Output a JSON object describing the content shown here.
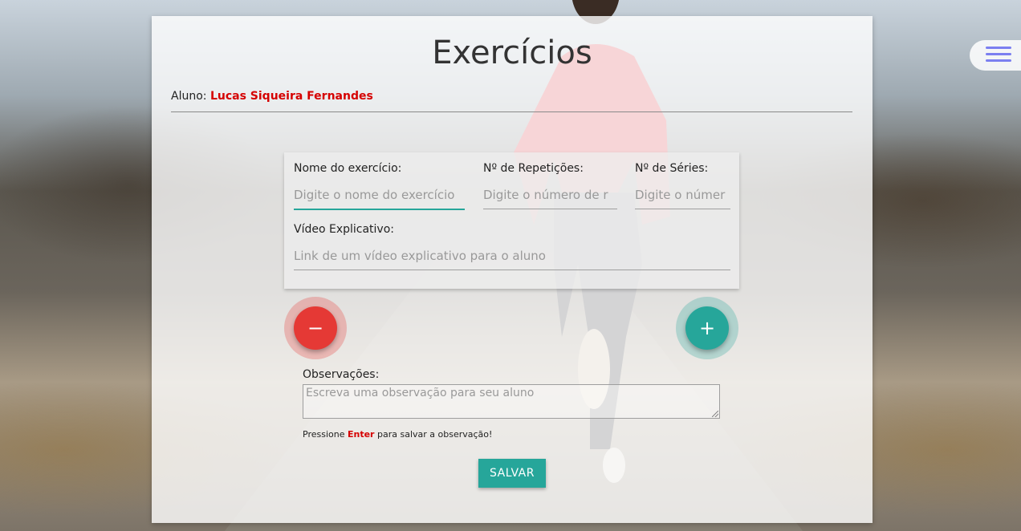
{
  "page": {
    "title": "Exercícios"
  },
  "student": {
    "label": "Aluno:",
    "name": "Lucas Siqueira Fernandes"
  },
  "exercise_form": {
    "name_label": "Nome do exercício:",
    "name_placeholder": "Digite o nome do exercício",
    "reps_label": "Nº de Repetições:",
    "reps_placeholder": "Digite o número de r",
    "sets_label": "Nº de Séries:",
    "sets_placeholder": "Digite o númer",
    "video_label": "Vídeo Explicativo:",
    "video_placeholder": "Link de um vídeo explicativo para o aluno"
  },
  "actions": {
    "remove_icon": "−",
    "add_icon": "+"
  },
  "observations": {
    "label": "Observações:",
    "placeholder": "Escreva uma observação para seu aluno",
    "hint_prefix": "Pressione",
    "hint_key": "Enter",
    "hint_suffix": "para salvar a observação!"
  },
  "save_button": "SALVAR",
  "colors": {
    "accent": "#26a69a",
    "danger": "#e53935",
    "highlight": "#d50000",
    "menu": "#7b7ff0"
  },
  "icons": {
    "menu": "hamburger-menu-icon",
    "remove": "minus-icon",
    "add": "plus-icon"
  }
}
